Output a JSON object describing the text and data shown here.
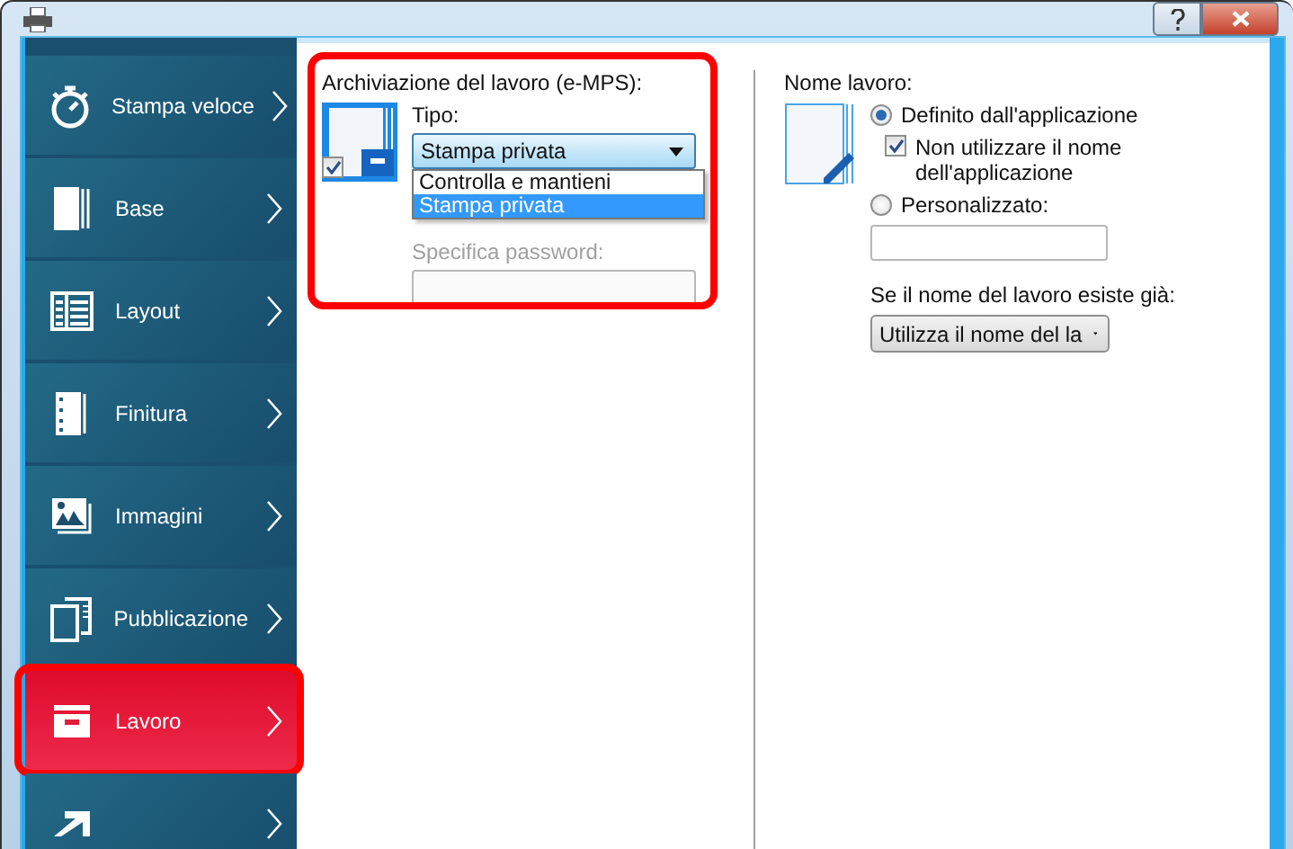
{
  "sidebar": {
    "items": [
      {
        "label": "Stampa veloce",
        "selected": false,
        "highlighted": false
      },
      {
        "label": "Base",
        "selected": false,
        "highlighted": false
      },
      {
        "label": "Layout",
        "selected": false,
        "highlighted": false
      },
      {
        "label": "Finitura",
        "selected": false,
        "highlighted": false
      },
      {
        "label": "Immagini",
        "selected": false,
        "highlighted": false
      },
      {
        "label": "Pubblicazione",
        "selected": false,
        "highlighted": false
      },
      {
        "label": "Lavoro",
        "selected": true,
        "highlighted": true
      },
      {
        "selected": false,
        "highlighted": false
      }
    ]
  },
  "job_storage": {
    "title": "Archiviazione del lavoro (e-MPS):",
    "highlighted": true,
    "checked": true,
    "type_label": "Tipo:",
    "type_value": "Stampa privata",
    "options": [
      {
        "label": "Controlla e mantieni",
        "selected": false
      },
      {
        "label": "Stampa privata",
        "selected": true
      }
    ],
    "password_label": "Specifica password:",
    "password_disabled": true
  },
  "job_name": {
    "title": "Nome lavoro:",
    "options": [
      {
        "label": "Definito dall'applicazione",
        "selected": true
      },
      {
        "label": "Personalizzato:",
        "selected": false
      }
    ],
    "dont_use_app_name": {
      "label": "Non utilizzare il nome dell'applicazione",
      "checked": true
    },
    "exists_label": "Se il nome del lavoro esiste già:",
    "exists_value": "Utilizza il nome del la"
  }
}
